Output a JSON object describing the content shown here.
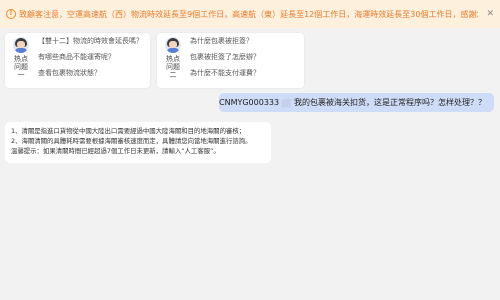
{
  "notice": {
    "icon": "warning-circle-icon",
    "text": "致顧客注意，空運高速航（西）物流時效延長至9個工作日，高速航（東）延長至12個工作日，海運時效延長至30個工作日，感謝您的理解與支持",
    "close_icon": "close-icon"
  },
  "faq_cards": [
    {
      "label": "热点问题一",
      "items": [
        "【雙十二】物流的時效會延長嗎？",
        "有哪些商品不能運寄呢？",
        "查看包裹物流狀態？"
      ]
    },
    {
      "label": "热点问题二",
      "items": [
        "為什麼包裹被拒簽？",
        "包裹被拒簽了怎麼辦？",
        "為什麼不能支付運費？"
      ]
    }
  ],
  "user_message": {
    "order_id": "CNMYG000333",
    "text": "我的包裹被海关扣货，这是正常程序吗？怎样处理？？"
  },
  "bot_message": {
    "lines": [
      "1、清關是指進口貨物從中國大陸出口需要經過中國大陸海關和目的地海關的審核；",
      "2、海關清關的具體耗時需要根據海關審核速度而定，具體請您向當地海關進行諮詢。",
      "溫馨提示：如果清關時間已經超過7個工作日未更新，請輸入“人工客服”。"
    ]
  },
  "colors": {
    "notice_bg": "#fdf1de",
    "notice_text": "#e8792a",
    "user_bubble": "#cfdcf7",
    "background": "#f2f2f2"
  }
}
